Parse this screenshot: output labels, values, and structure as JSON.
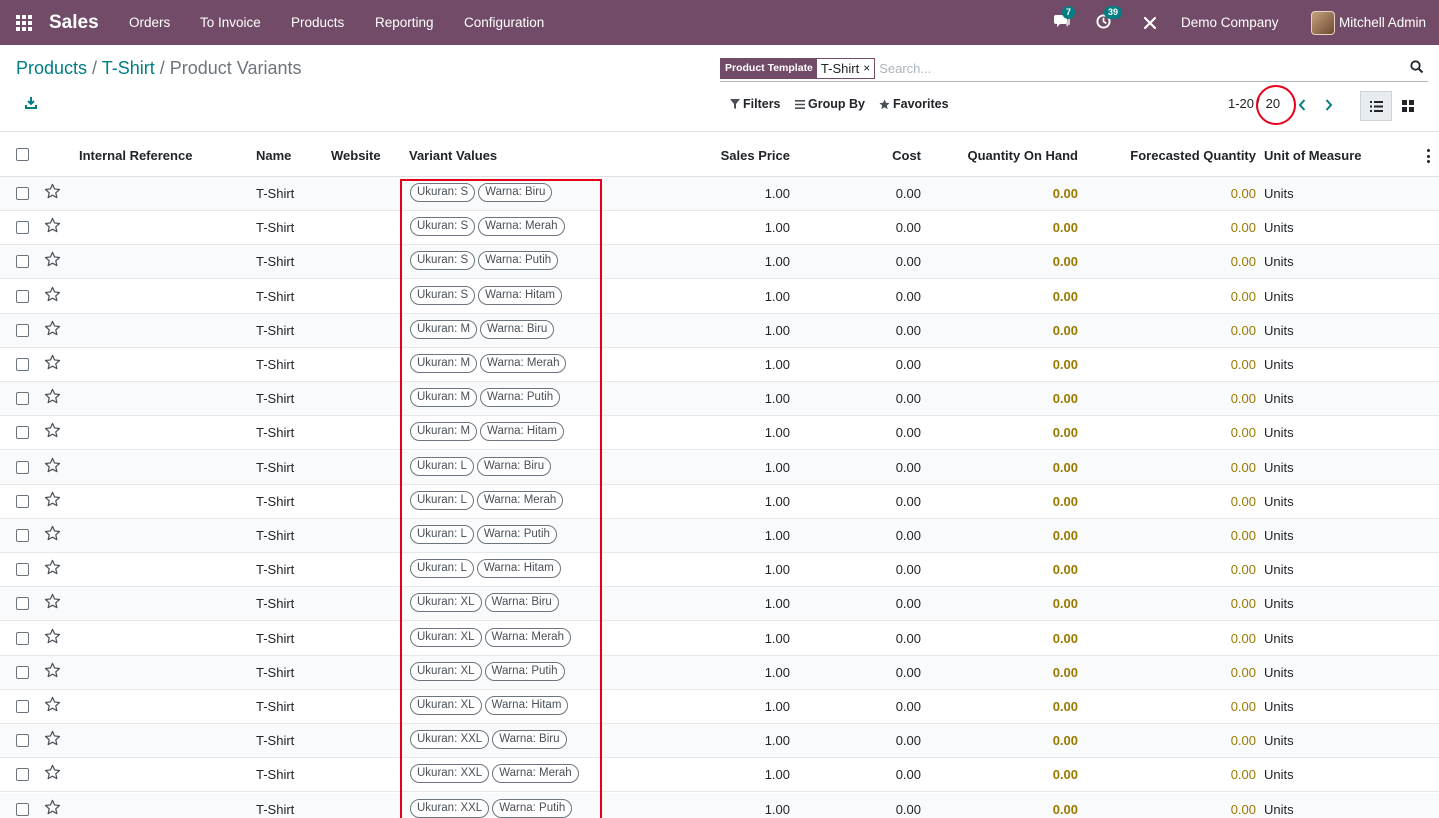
{
  "navbar": {
    "app_name": "Sales",
    "menu": [
      "Orders",
      "To Invoice",
      "Products",
      "Reporting",
      "Configuration"
    ],
    "messages_count": "7",
    "activities_count": "39",
    "company": "Demo Company",
    "user": "Mitchell Admin",
    "colors": {
      "brand": "#714B67",
      "badge": "#017E84"
    }
  },
  "breadcrumb": {
    "root": "Products",
    "sep1": " / ",
    "parent": "T-Shirt",
    "sep2": " / ",
    "current": "Product Variants"
  },
  "search": {
    "facet_category": "Product Template",
    "facet_value": "T-Shirt",
    "facet_remove": "×",
    "placeholder": "Search...",
    "filters_label": "Filters",
    "groupby_label": "Group By",
    "favorites_label": "Favorites"
  },
  "pager": {
    "range": "1-20",
    "separator": "/",
    "total": "20"
  },
  "columns": {
    "internal_reference": "Internal Reference",
    "name": "Name",
    "website": "Website",
    "variant_values": "Variant Values",
    "sales_price": "Sales Price",
    "cost": "Cost",
    "qty_on_hand": "Quantity On Hand",
    "forecasted_qty": "Forecasted Quantity",
    "uom": "Unit of Measure"
  },
  "rows": [
    {
      "name": "T-Shirt",
      "size": "Ukuran: S",
      "color": "Warna: Biru",
      "price": "1.00",
      "cost": "0.00",
      "on_hand": "0.00",
      "forecast": "0.00",
      "uom": "Units"
    },
    {
      "name": "T-Shirt",
      "size": "Ukuran: S",
      "color": "Warna: Merah",
      "price": "1.00",
      "cost": "0.00",
      "on_hand": "0.00",
      "forecast": "0.00",
      "uom": "Units"
    },
    {
      "name": "T-Shirt",
      "size": "Ukuran: S",
      "color": "Warna: Putih",
      "price": "1.00",
      "cost": "0.00",
      "on_hand": "0.00",
      "forecast": "0.00",
      "uom": "Units"
    },
    {
      "name": "T-Shirt",
      "size": "Ukuran: S",
      "color": "Warna: Hitam",
      "price": "1.00",
      "cost": "0.00",
      "on_hand": "0.00",
      "forecast": "0.00",
      "uom": "Units"
    },
    {
      "name": "T-Shirt",
      "size": "Ukuran: M",
      "color": "Warna: Biru",
      "price": "1.00",
      "cost": "0.00",
      "on_hand": "0.00",
      "forecast": "0.00",
      "uom": "Units"
    },
    {
      "name": "T-Shirt",
      "size": "Ukuran: M",
      "color": "Warna: Merah",
      "price": "1.00",
      "cost": "0.00",
      "on_hand": "0.00",
      "forecast": "0.00",
      "uom": "Units"
    },
    {
      "name": "T-Shirt",
      "size": "Ukuran: M",
      "color": "Warna: Putih",
      "price": "1.00",
      "cost": "0.00",
      "on_hand": "0.00",
      "forecast": "0.00",
      "uom": "Units"
    },
    {
      "name": "T-Shirt",
      "size": "Ukuran: M",
      "color": "Warna: Hitam",
      "price": "1.00",
      "cost": "0.00",
      "on_hand": "0.00",
      "forecast": "0.00",
      "uom": "Units"
    },
    {
      "name": "T-Shirt",
      "size": "Ukuran: L",
      "color": "Warna: Biru",
      "price": "1.00",
      "cost": "0.00",
      "on_hand": "0.00",
      "forecast": "0.00",
      "uom": "Units"
    },
    {
      "name": "T-Shirt",
      "size": "Ukuran: L",
      "color": "Warna: Merah",
      "price": "1.00",
      "cost": "0.00",
      "on_hand": "0.00",
      "forecast": "0.00",
      "uom": "Units"
    },
    {
      "name": "T-Shirt",
      "size": "Ukuran: L",
      "color": "Warna: Putih",
      "price": "1.00",
      "cost": "0.00",
      "on_hand": "0.00",
      "forecast": "0.00",
      "uom": "Units"
    },
    {
      "name": "T-Shirt",
      "size": "Ukuran: L",
      "color": "Warna: Hitam",
      "price": "1.00",
      "cost": "0.00",
      "on_hand": "0.00",
      "forecast": "0.00",
      "uom": "Units"
    },
    {
      "name": "T-Shirt",
      "size": "Ukuran: XL",
      "color": "Warna: Biru",
      "price": "1.00",
      "cost": "0.00",
      "on_hand": "0.00",
      "forecast": "0.00",
      "uom": "Units"
    },
    {
      "name": "T-Shirt",
      "size": "Ukuran: XL",
      "color": "Warna: Merah",
      "price": "1.00",
      "cost": "0.00",
      "on_hand": "0.00",
      "forecast": "0.00",
      "uom": "Units"
    },
    {
      "name": "T-Shirt",
      "size": "Ukuran: XL",
      "color": "Warna: Putih",
      "price": "1.00",
      "cost": "0.00",
      "on_hand": "0.00",
      "forecast": "0.00",
      "uom": "Units"
    },
    {
      "name": "T-Shirt",
      "size": "Ukuran: XL",
      "color": "Warna: Hitam",
      "price": "1.00",
      "cost": "0.00",
      "on_hand": "0.00",
      "forecast": "0.00",
      "uom": "Units"
    },
    {
      "name": "T-Shirt",
      "size": "Ukuran: XXL",
      "color": "Warna: Biru",
      "price": "1.00",
      "cost": "0.00",
      "on_hand": "0.00",
      "forecast": "0.00",
      "uom": "Units"
    },
    {
      "name": "T-Shirt",
      "size": "Ukuran: XXL",
      "color": "Warna: Merah",
      "price": "1.00",
      "cost": "0.00",
      "on_hand": "0.00",
      "forecast": "0.00",
      "uom": "Units"
    },
    {
      "name": "T-Shirt",
      "size": "Ukuran: XXL",
      "color": "Warna: Putih",
      "price": "1.00",
      "cost": "0.00",
      "on_hand": "0.00",
      "forecast": "0.00",
      "uom": "Units"
    }
  ]
}
